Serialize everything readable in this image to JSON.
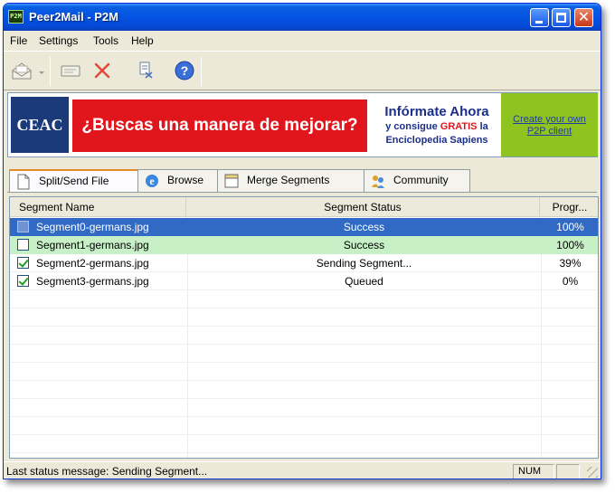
{
  "window": {
    "title": "Peer2Mail - P2M",
    "icon_label": "P2M"
  },
  "menu": [
    "File",
    "Settings",
    "Tools",
    "Help"
  ],
  "toolbar": {
    "buttons": [
      {
        "icon": "mail-open-icon"
      },
      {
        "icon": "dropdown-arrow-icon"
      },
      {
        "icon": "card-icon"
      },
      {
        "icon": "delete-x-icon"
      },
      {
        "icon": "split-file-icon"
      },
      {
        "icon": "help-icon"
      }
    ]
  },
  "banner": {
    "logo": "CEAC",
    "headline": "¿Buscas una manera de mejorar?",
    "right_title": "Infórmate Ahora",
    "right_line1_pre": "y consigue ",
    "right_line1_bold": "GRATIS",
    "right_line1_post": " la",
    "right_line2": "Enciclopedia Sapiens",
    "create_line1": "Create your own",
    "create_line2": "P2P client"
  },
  "tabs": [
    {
      "label": "Split/Send File",
      "icon": "file-icon",
      "active": true
    },
    {
      "label": "Browse",
      "icon": "ie-globe-icon",
      "active": false
    },
    {
      "label": "Merge Segments",
      "icon": "merge-icon",
      "active": false
    },
    {
      "label": "Community",
      "icon": "community-icon",
      "active": false
    }
  ],
  "list": {
    "columns": [
      "Segment Name",
      "Segment Status",
      "Progr..."
    ],
    "rows": [
      {
        "name": "Segment0-germans.jpg",
        "status": "Success",
        "progress": "100%",
        "checked": false,
        "state": "selected"
      },
      {
        "name": "Segment1-germans.jpg",
        "status": "Success",
        "progress": "100%",
        "checked": false,
        "state": "highlight"
      },
      {
        "name": "Segment2-germans.jpg",
        "status": "Sending Segment...",
        "progress": "39%",
        "checked": true,
        "state": "normal"
      },
      {
        "name": "Segment3-germans.jpg",
        "status": "Queued",
        "progress": "0%",
        "checked": true,
        "state": "normal"
      }
    ]
  },
  "status": {
    "message": "Last status message: Sending Segment...",
    "num": "NUM"
  }
}
